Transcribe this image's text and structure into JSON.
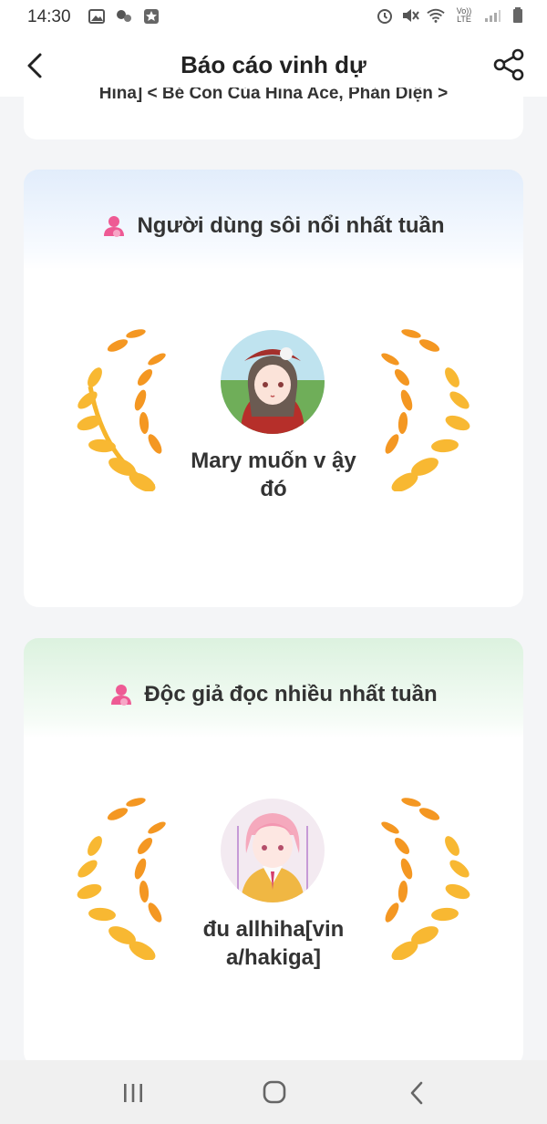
{
  "status_bar": {
    "time": "14:30",
    "network": "Vo)) LTE"
  },
  "header": {
    "title": "Báo cáo vinh dự"
  },
  "previous_card": {
    "text": "Hina] < Bé Con Của Hina Ace, Phản Diện >"
  },
  "sections": [
    {
      "heading": "Người dùng sôi nổi nhất tuần",
      "username": "Mary muốn v ậy đó",
      "accent": "#e2edfb"
    },
    {
      "heading": "Độc giả đọc nhiều nhất tuần",
      "username": "đu allhiha[vin a/hakiga]",
      "accent": "#dcf2df"
    }
  ],
  "icons": {
    "back": "back-arrow-icon",
    "share": "share-icon",
    "section": "user-icon",
    "wreath": "laurel-wreath-icon"
  },
  "colors": {
    "wreath_gold": "#f6b52b",
    "wreath_orange": "#f38a1c",
    "user_icon_pink": "#ee5a94"
  }
}
